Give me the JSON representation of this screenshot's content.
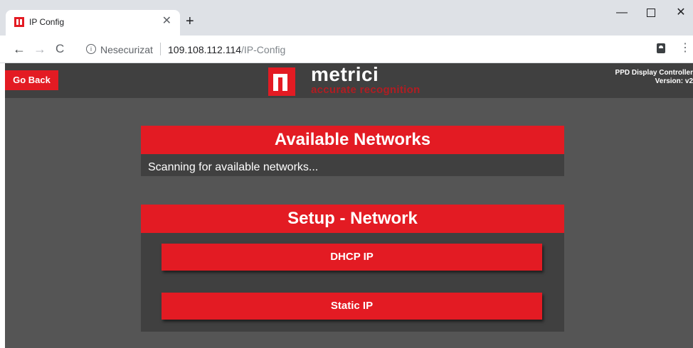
{
  "browser": {
    "tab_title": "IP Config",
    "tab_close": "✕",
    "new_tab": "+",
    "window_min": "—",
    "window_close": "✕",
    "nav_back": "←",
    "nav_forward": "→",
    "nav_reload": "C",
    "info_icon": "i",
    "security_label": "Nesecurizat",
    "url_host": "109.108.112.114",
    "url_path": "/IP-Config",
    "menu": "⋮"
  },
  "header": {
    "go_back_label": "Go Back",
    "logo_name": "metrici",
    "logo_tagline": "accurate recognition",
    "product_name": "PPD Display Controller",
    "product_version": "Version: v2"
  },
  "available_networks": {
    "title": "Available Networks",
    "status": "Scanning for available networks..."
  },
  "setup_network": {
    "title": "Setup - Network",
    "buttons": [
      {
        "label": "DHCP IP"
      },
      {
        "label": "Static IP"
      }
    ]
  },
  "colors": {
    "accent": "#e31b23",
    "page_background": "#555555",
    "panel_background": "#404040",
    "chrome_background": "#dee1e6"
  }
}
